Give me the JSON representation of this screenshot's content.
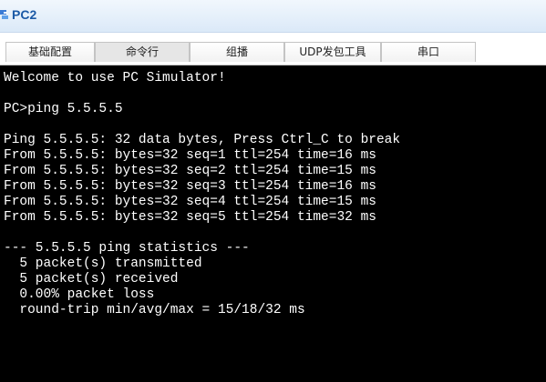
{
  "window": {
    "title": "PC2",
    "icon": "pc-icon"
  },
  "tabs": [
    {
      "label": "基础配置"
    },
    {
      "label": "命令行"
    },
    {
      "label": "组播"
    },
    {
      "label": "UDP发包工具"
    },
    {
      "label": "串口"
    }
  ],
  "active_tab": "命令行",
  "console": {
    "lines": [
      "Welcome to use PC Simulator!",
      "",
      "PC>ping 5.5.5.5",
      "",
      "Ping 5.5.5.5: 32 data bytes, Press Ctrl_C to break",
      "From 5.5.5.5: bytes=32 seq=1 ttl=254 time=16 ms",
      "From 5.5.5.5: bytes=32 seq=2 ttl=254 time=15 ms",
      "From 5.5.5.5: bytes=32 seq=3 ttl=254 time=16 ms",
      "From 5.5.5.5: bytes=32 seq=4 ttl=254 time=15 ms",
      "From 5.5.5.5: bytes=32 seq=5 ttl=254 time=32 ms",
      "",
      "--- 5.5.5.5 ping statistics ---",
      "  5 packet(s) transmitted",
      "  5 packet(s) received",
      "  0.00% packet loss",
      "  round-trip min/avg/max = 15/18/32 ms"
    ]
  },
  "colors": {
    "title": "#1c5aa6",
    "console_bg": "#000000",
    "console_fg": "#ffffff"
  }
}
